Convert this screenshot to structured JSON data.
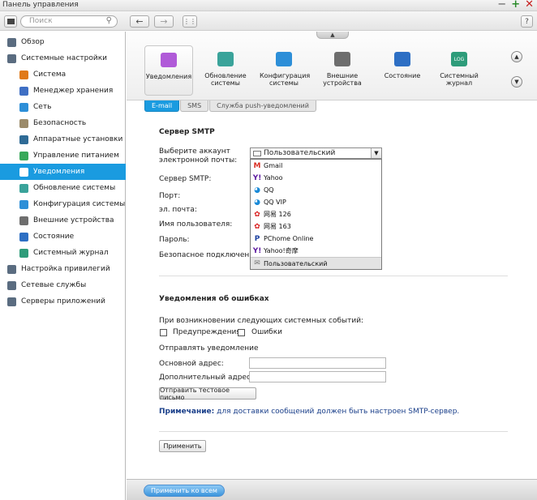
{
  "window": {
    "title": "Панель управления"
  },
  "toolbar": {
    "search_placeholder": "Поиск"
  },
  "sidebar": {
    "items": [
      {
        "label": "Обзор",
        "level": "top",
        "color": "#5a6c80"
      },
      {
        "label": "Системные настройки",
        "level": "top",
        "color": "#5a6c80"
      },
      {
        "label": "Система",
        "level": "sub",
        "color": "#e07a1a"
      },
      {
        "label": "Менеджер хранения",
        "level": "sub",
        "color": "#3f6fc4"
      },
      {
        "label": "Сеть",
        "level": "sub",
        "color": "#2d8fd8"
      },
      {
        "label": "Безопасность",
        "level": "sub",
        "color": "#9b8b6a"
      },
      {
        "label": "Аппаратные установки",
        "level": "sub",
        "color": "#2f6b96"
      },
      {
        "label": "Управление питанием",
        "level": "sub",
        "color": "#39a85a"
      },
      {
        "label": "Уведомления",
        "level": "sub",
        "color": "#b05ad8",
        "active": true
      },
      {
        "label": "Обновление системы",
        "level": "sub",
        "color": "#3aa39a"
      },
      {
        "label": "Конфигурация системы",
        "level": "sub",
        "color": "#2d8fd8"
      },
      {
        "label": "Внешние устройства",
        "level": "sub",
        "color": "#6e6e6e"
      },
      {
        "label": "Состояние",
        "level": "sub",
        "color": "#2d6fc4"
      },
      {
        "label": "Системный журнал",
        "level": "sub",
        "color": "#2e9c7a"
      },
      {
        "label": "Настройка привилегий",
        "level": "top",
        "color": "#5a6c80"
      },
      {
        "label": "Сетевые службы",
        "level": "top",
        "color": "#5a6c80"
      },
      {
        "label": "Серверы приложений",
        "level": "top",
        "color": "#5a6c80"
      }
    ]
  },
  "iconbar": {
    "apps": [
      {
        "label": "Уведомления",
        "icon": "chat-icon",
        "color": "#b05ad8",
        "selected": true
      },
      {
        "label": "Обновление системы",
        "icon": "update-icon",
        "color": "#3aa39a"
      },
      {
        "label": "Конфигурация системы",
        "icon": "config-icon",
        "color": "#2d8fd8"
      },
      {
        "label": "Внешние устройства",
        "icon": "drive-icon",
        "color": "#6e6e6e"
      },
      {
        "label": "Состояние",
        "icon": "monitor-icon",
        "color": "#2d6fc4"
      },
      {
        "label": "Системный журнал",
        "icon": "log-icon",
        "color": "#2e9c7a",
        "badge": "LOG"
      }
    ]
  },
  "tabs": [
    {
      "label": "E-mail",
      "active": true
    },
    {
      "label": "SMS"
    },
    {
      "label": "Служба push-уведомлений"
    }
  ],
  "smtp": {
    "title": "Сервер SMTP",
    "account_label": "Выберите аккаунт электронной почты:",
    "server_label": "Сервер SMTP:",
    "port_label": "Порт:",
    "email_label": "эл. почта:",
    "username_label": "Имя пользователя:",
    "password_label": "Пароль:",
    "secure_label": "Безопасное подключение:",
    "selected_account": "Пользовательский",
    "options": [
      {
        "label": "Gmail",
        "icon": "gmail-icon",
        "glyph": "M",
        "color": "#d93025"
      },
      {
        "label": "Yahoo",
        "icon": "yahoo-icon",
        "glyph": "Y!",
        "color": "#5c1aa0"
      },
      {
        "label": "QQ",
        "icon": "qq-icon",
        "glyph": "◕",
        "color": "#1a8ad8"
      },
      {
        "label": "QQ VIP",
        "icon": "qq-vip-icon",
        "glyph": "◕",
        "color": "#1a8ad8"
      },
      {
        "label": "网易 126",
        "icon": "netease-126-icon",
        "glyph": "✿",
        "color": "#d81a1a"
      },
      {
        "label": "网易 163",
        "icon": "netease-163-icon",
        "glyph": "✿",
        "color": "#d81a1a"
      },
      {
        "label": "PChome Online",
        "icon": "pchome-icon",
        "glyph": "P",
        "color": "#1a3fa0"
      },
      {
        "label": "Yahoo!奇摩",
        "icon": "yahoo-kimo-icon",
        "glyph": "Y!",
        "color": "#5c1aa0"
      },
      {
        "label": "Пользовательский",
        "icon": "envelope-icon",
        "glyph": "✉",
        "color": "#777777",
        "selected": true
      }
    ]
  },
  "alerts": {
    "title": "Уведомления об ошибках",
    "events_label": "При возникновении следующих системных событий:",
    "warnings_label": "Предупреждения",
    "errors_label": "Ошибки",
    "send_label": "Отправлять уведомление",
    "primary_label": "Основной адрес:",
    "secondary_label": "Дополнительный адрес:",
    "test_button": "Отправить тестовое письмо",
    "note_prefix": "Примечание:",
    "note_text": " для доставки сообщений должен быть настроен SMTP-сервер."
  },
  "actions": {
    "apply": "Применить",
    "apply_all": "Применить ко всем"
  }
}
